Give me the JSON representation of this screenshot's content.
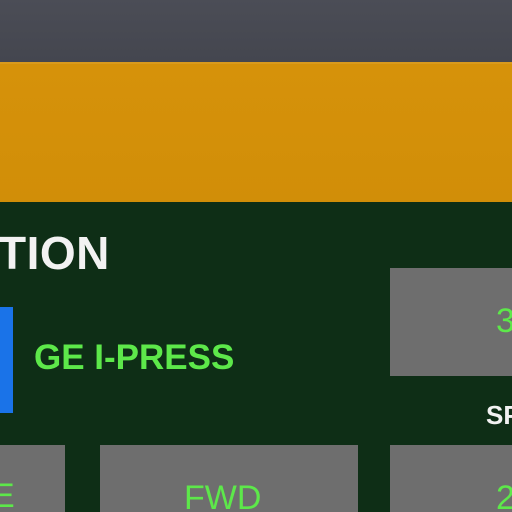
{
  "screen": {
    "section_title": "TION",
    "machine_name": "GE I-PRESS",
    "status_indicator_color": "#1a73e8"
  },
  "tiles": {
    "right_top_value": "3",
    "left_bottom_label": "E",
    "fwd_label": "FWD",
    "right_bottom_value": "2"
  },
  "labels": {
    "speed_label_partial": "SP"
  },
  "colors": {
    "banner": "#d6920a",
    "panel_background": "#0e2e16",
    "tile_background": "#6e6e6e",
    "accent_text": "#5de84a"
  }
}
